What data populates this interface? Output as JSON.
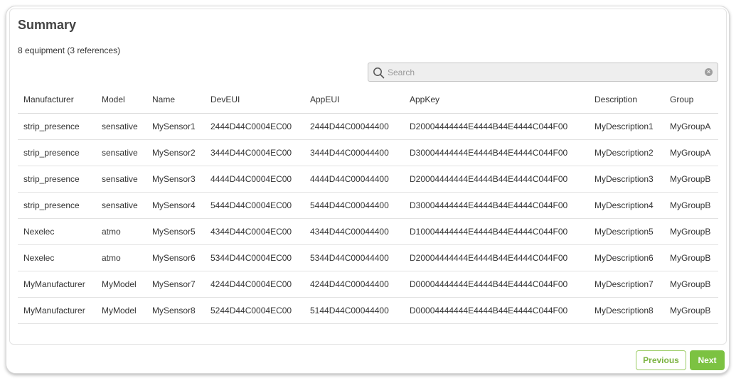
{
  "summary": {
    "title": "Summary",
    "count_text": "8 equipment (3 references)"
  },
  "search": {
    "placeholder": "Search",
    "value": ""
  },
  "table": {
    "headers": [
      "Manufacturer",
      "Model",
      "Name",
      "DevEUI",
      "AppEUI",
      "AppKey",
      "Description",
      "Group"
    ],
    "rows": [
      [
        "strip_presence",
        "sensative",
        "MySensor1",
        "2444D44C0004EC00",
        "2444D44C00044400",
        "D20004444444E4444B44E4444C044F00",
        "MyDescription1",
        "MyGroupA"
      ],
      [
        "strip_presence",
        "sensative",
        "MySensor2",
        "3444D44C0004EC00",
        "3444D44C00044400",
        "D30004444444E4444B44E4444C044F00",
        "MyDescription2",
        "MyGroupA"
      ],
      [
        "strip_presence",
        "sensative",
        "MySensor3",
        "4444D44C0004EC00",
        "4444D44C00044400",
        "D20004444444E4444B44E4444C044F00",
        "MyDescription3",
        "MyGroupB"
      ],
      [
        "strip_presence",
        "sensative",
        "MySensor4",
        "5444D44C0004EC00",
        "5444D44C00044400",
        "D30004444444E4444B44E4444C044F00",
        "MyDescription4",
        "MyGroupB"
      ],
      [
        "Nexelec",
        "atmo",
        "MySensor5",
        "4344D44C0004EC00",
        "4344D44C00044400",
        "D10004444444E4444B44E4444C044F00",
        "MyDescription5",
        "MyGroupB"
      ],
      [
        "Nexelec",
        "atmo",
        "MySensor6",
        "5344D44C0004EC00",
        "5344D44C00044400",
        "D20004444444E4444B44E4444C044F00",
        "MyDescription6",
        "MyGroupB"
      ],
      [
        "MyManufacturer",
        "MyModel",
        "MySensor7",
        "4244D44C0004EC00",
        "4244D44C00044400",
        "D00004444444E4444B44E4444C044F00",
        "MyDescription7",
        "MyGroupB"
      ],
      [
        "MyManufacturer",
        "MyModel",
        "MySensor8",
        "5244D44C0004EC00",
        "5144D44C00044400",
        "D00004444444E4444B44E4444C044F00",
        "MyDescription8",
        "MyGroupB"
      ]
    ]
  },
  "pagination": {
    "previous_label": "Previous",
    "next_label": "Next"
  },
  "colors": {
    "accent": "#7cc242",
    "text": "#333333",
    "title": "#444444"
  },
  "icons": {
    "search": "search-icon",
    "clear": "clear-icon"
  }
}
